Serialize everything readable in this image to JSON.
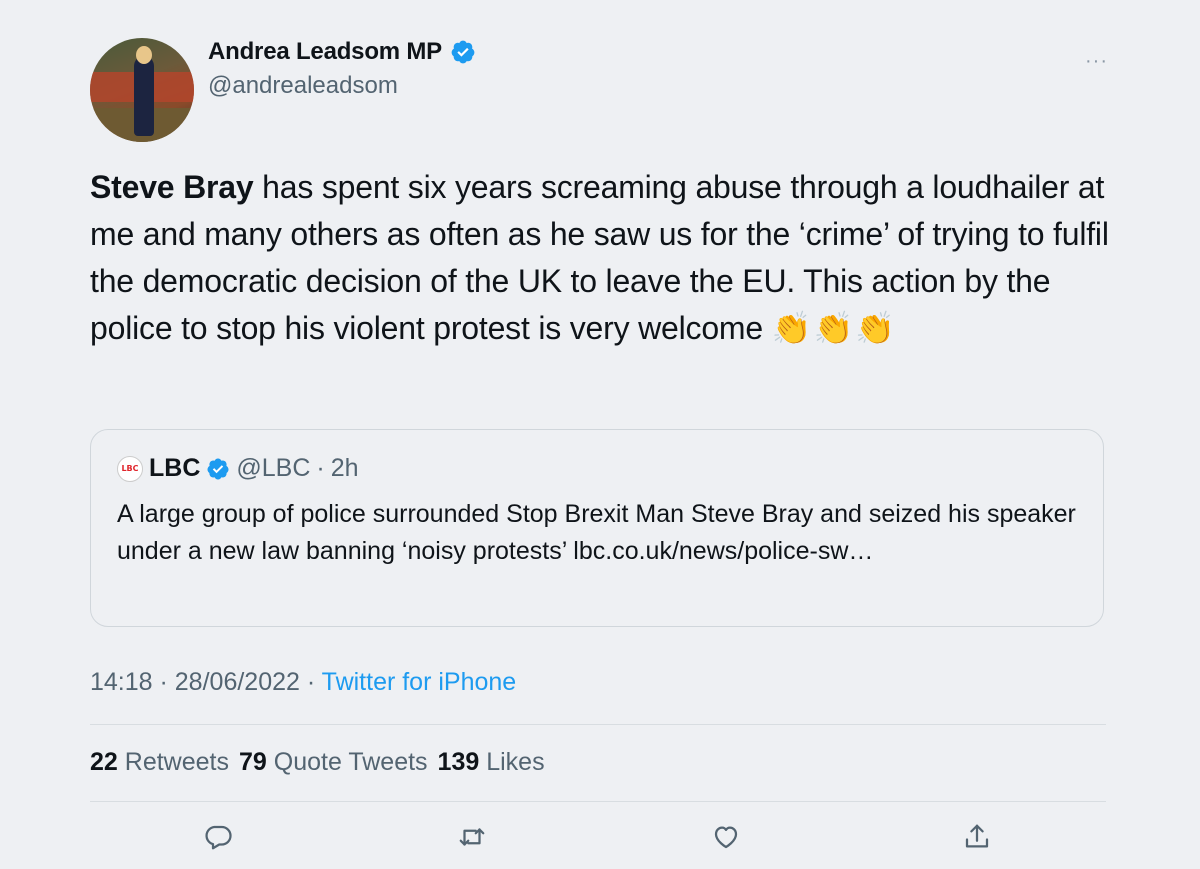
{
  "author": {
    "name": "Andrea Leadsom MP",
    "handle": "@andrealeadsom"
  },
  "tweet": {
    "bold_name": "Steve Bray",
    "text": " has spent six years screaming abuse through a loudhailer at me and many others as often as he saw us for the ‘crime’ of trying to fulfil the democratic decision of the UK to leave the EU.  This action by the police to stop his violent protest is very welcome ",
    "emoji": "👏👏👏"
  },
  "quote": {
    "logo_text": "LBC",
    "name": "LBC",
    "handle": "@LBC",
    "separator": "·",
    "time": "2h",
    "text": "A large group of police surrounded Stop Brexit Man Steve Bray and seized his speaker under a new law banning ‘noisy protests’ lbc.co.uk/news/police-sw…"
  },
  "meta": {
    "time": "14:18",
    "separator": " · ",
    "date": "28/06/2022",
    "separator2": " · ",
    "source": "Twitter for iPhone"
  },
  "stats": {
    "retweets_count": "22",
    "retweets_label": "Retweets",
    "quotes_count": "79",
    "quotes_label": "Quote Tweets",
    "likes_count": "139",
    "likes_label": "Likes"
  },
  "more_icon": "···",
  "colors": {
    "background": "#eef0f3",
    "text": "#0f1419",
    "secondary": "#536471",
    "accent": "#1d9bf0",
    "verified": "#1d9bf0"
  },
  "icons": [
    "verified-badge-icon",
    "more-icon",
    "reply-icon",
    "retweet-icon",
    "like-icon",
    "share-icon"
  ]
}
